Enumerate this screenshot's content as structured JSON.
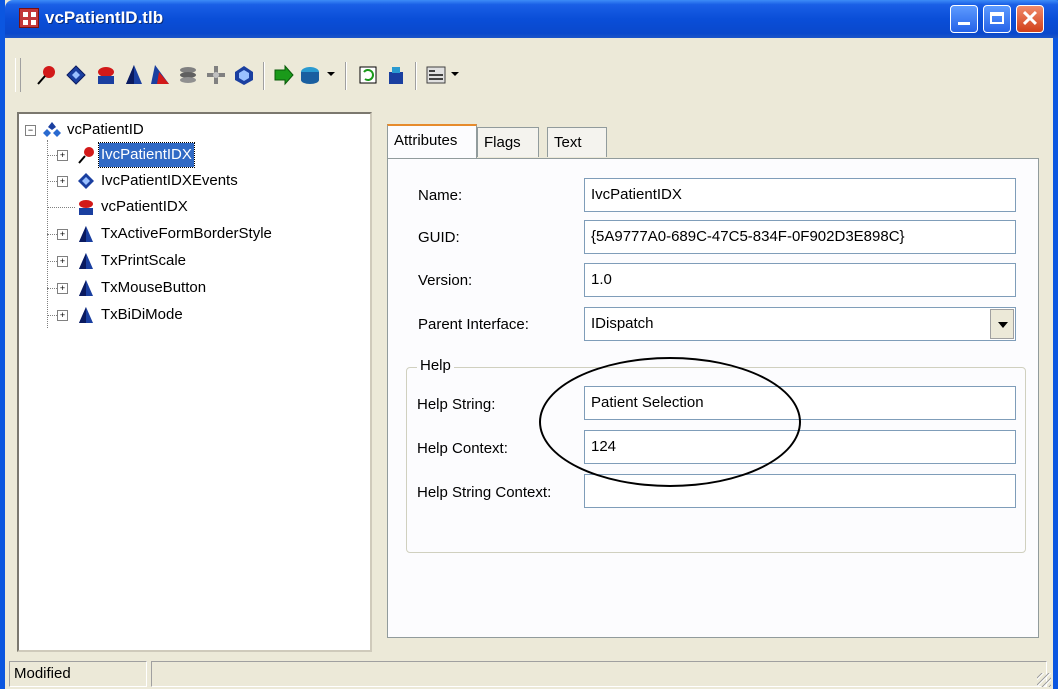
{
  "window": {
    "title": "vcPatientID.tlb"
  },
  "toolbar": {
    "icons": [
      "interface-icon",
      "dispinterface-icon",
      "coclass-icon",
      "enum-icon",
      "record-icon",
      "module-icon",
      "union-icon",
      "alias-icon",
      "import-icon",
      "typelib-icon",
      "refresh-icon",
      "register-icon",
      "view-icon"
    ]
  },
  "tree": {
    "root": "vcPatientID",
    "items": [
      {
        "label": "IvcPatientIDX",
        "icon": "interface-icon",
        "selected": true,
        "expandable": true
      },
      {
        "label": "IvcPatientIDXEvents",
        "icon": "dispinterface-icon",
        "selected": false,
        "expandable": true
      },
      {
        "label": "vcPatientIDX",
        "icon": "coclass-icon",
        "selected": false,
        "expandable": false
      },
      {
        "label": "TxActiveFormBorderStyle",
        "icon": "enum-icon",
        "selected": false,
        "expandable": true
      },
      {
        "label": "TxPrintScale",
        "icon": "enum-icon",
        "selected": false,
        "expandable": true
      },
      {
        "label": "TxMouseButton",
        "icon": "enum-icon",
        "selected": false,
        "expandable": true
      },
      {
        "label": "TxBiDiMode",
        "icon": "enum-icon",
        "selected": false,
        "expandable": true
      }
    ]
  },
  "tabs": [
    {
      "label": "Attributes",
      "active": true
    },
    {
      "label": "Flags",
      "active": false
    },
    {
      "label": "Text",
      "active": false
    }
  ],
  "attributes": {
    "name_label": "Name:",
    "name_value": "IvcPatientIDX",
    "guid_label": "GUID:",
    "guid_value": "{5A9777A0-689C-47C5-834F-0F902D3E898C}",
    "version_label": "Version:",
    "version_value": "1.0",
    "parent_label": "Parent Interface:",
    "parent_value": "IDispatch"
  },
  "help": {
    "group_title": "Help",
    "string_label": "Help String:",
    "string_value": "Patient Selection",
    "context_label": "Help Context:",
    "context_value": "124",
    "string_context_label": "Help String Context:",
    "string_context_value": ""
  },
  "status": {
    "text": "Modified"
  },
  "colors": {
    "title_bar": "#0a4ed8",
    "selection": "#316ac5",
    "window_bg": "#ece9d8"
  }
}
